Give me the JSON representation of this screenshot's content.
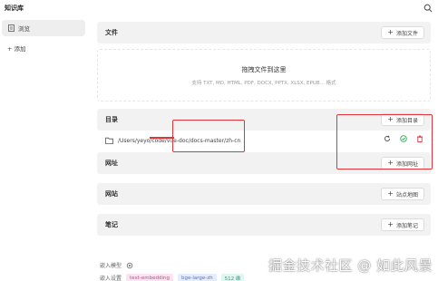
{
  "app": {
    "title": "知识库"
  },
  "sidebar": {
    "items": [
      {
        "label": "浏览",
        "icon": "document-icon",
        "active": true
      },
      {
        "label": "+ 添加",
        "icon": "",
        "active": false
      }
    ]
  },
  "sections": {
    "files": {
      "title": "文件",
      "button": "添加文件"
    },
    "dropzone": {
      "title": "拖拽文件到这里",
      "subtitle": "支持 TXT, MD, HTML, PDF, DOCX, PPTX, XLSX, EPUB... 格式"
    },
    "directory": {
      "title": "目录",
      "button": "添加目录",
      "row_path": "/Users/yeyo/code/vue-doc/docs-master/zh-cn"
    },
    "url": {
      "title": "网址",
      "button": "添加网址"
    },
    "sitemap": {
      "title": "网站",
      "button": "站点地图"
    },
    "notes": {
      "title": "笔记",
      "button": "添加笔记"
    }
  },
  "footer": {
    "embed_label": "嵌入模型",
    "tags_label": "嵌入设置",
    "tags": [
      "text-embedding",
      "bge-large-zh",
      "512 维"
    ]
  },
  "watermark": "掘金技术社区 @ 如此风景",
  "colors": {
    "annotation": "#e0343a",
    "check": "#2eaa4a",
    "delete": "#e0343a",
    "tag1_bg": "#fbe3f1",
    "tag2_bg": "#e4ecff",
    "tag3_bg": "#e1f6f0"
  }
}
